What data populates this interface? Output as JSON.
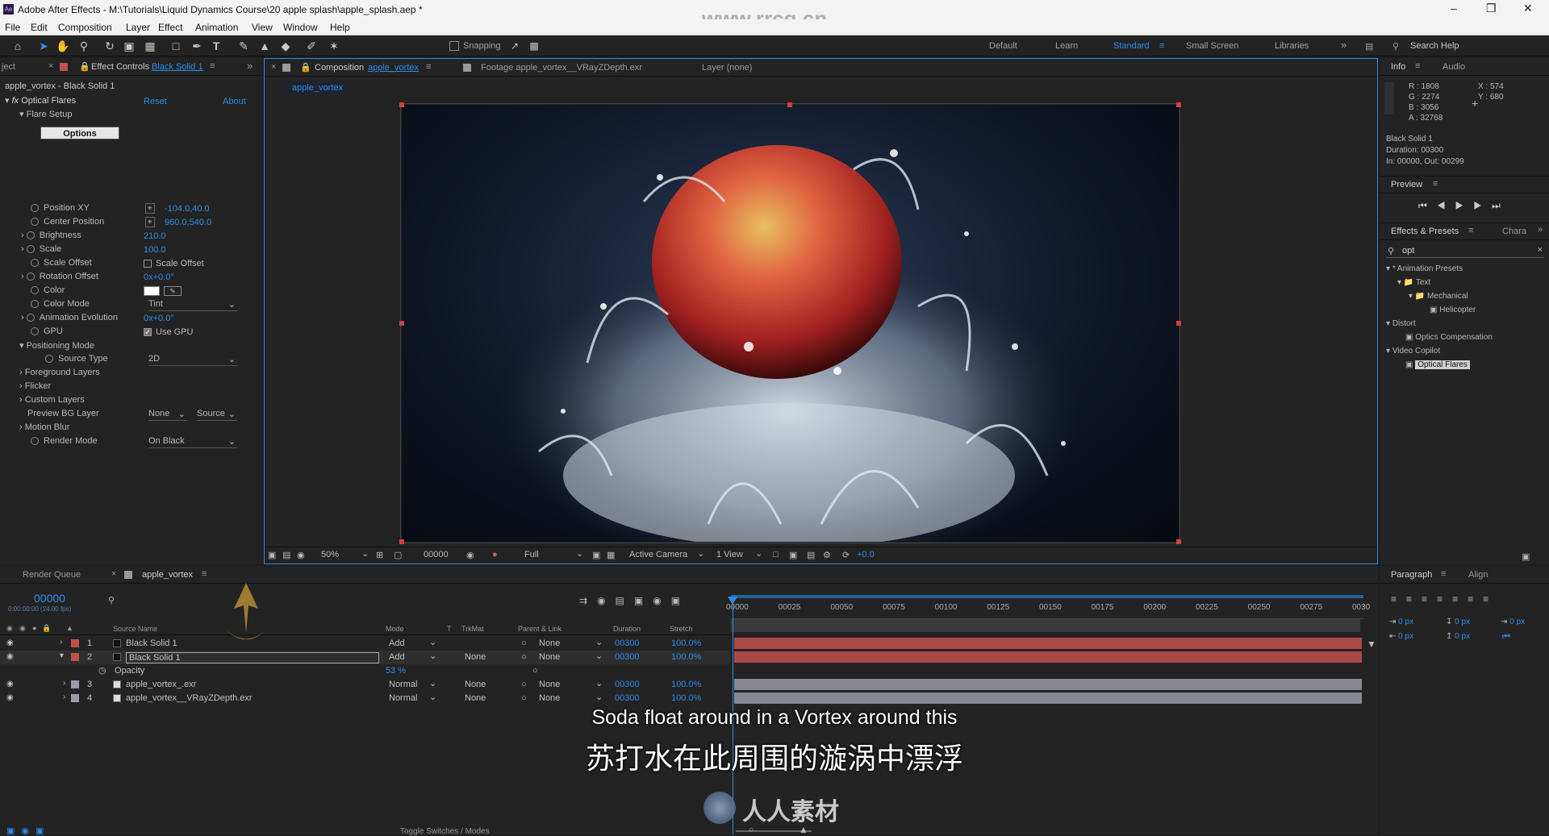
{
  "window": {
    "title": "Adobe After Effects - M:\\Tutorials\\Liquid Dynamics Course\\20 apple splash\\apple_splash.aep *",
    "watermark_url": "www.rrcg.cn"
  },
  "menu": [
    "File",
    "Edit",
    "Composition",
    "Layer",
    "Effect",
    "Animation",
    "View",
    "Window",
    "Help"
  ],
  "toolbar": {
    "snapping": "Snapping",
    "workspaces": [
      "Default",
      "Learn",
      "Standard",
      "Small Screen",
      "Libraries"
    ],
    "search": "Search Help"
  },
  "colors": {
    "accent": "#2d8ceb",
    "layer_red": "#c0504d",
    "layer_gray": "#9a9aa8",
    "bg": "#232323"
  },
  "effect_controls": {
    "tabs": [
      "ject",
      "Effect Controls",
      "Black Solid 1"
    ],
    "layer_path": "apple_vortex - Black Solid 1",
    "effect_name": "Optical Flares",
    "reset": "Reset",
    "about": "About",
    "flare_setup": "Flare Setup",
    "options_button": "Options",
    "props": [
      {
        "name": "Position XY",
        "value": "-104.0,40.0"
      },
      {
        "name": "Center Position",
        "value": "960.0,540.0"
      },
      {
        "name": "Brightness",
        "value": "210.0"
      },
      {
        "name": "Scale",
        "value": "100.0"
      },
      {
        "name": "Scale Offset",
        "value": "Scale Offset"
      },
      {
        "name": "Rotation Offset",
        "value": "0x+0.0°"
      },
      {
        "name": "Color",
        "value": ""
      },
      {
        "name": "Color Mode",
        "value": "Tint"
      },
      {
        "name": "Animation Evolution",
        "value": "0x+0.0°"
      },
      {
        "name": "GPU",
        "value": "Use GPU"
      }
    ],
    "positioning_mode": "Positioning Mode",
    "source_type_label": "Source Type",
    "source_type": "2D",
    "groups": [
      "Foreground Layers",
      "Flicker",
      "Custom Layers"
    ],
    "preview_bg_label": "Preview BG Layer",
    "preview_bg": "None",
    "preview_bg_source": "Source",
    "motion_blur": "Motion Blur",
    "render_mode_label": "Render Mode",
    "render_mode": "On Black"
  },
  "composition": {
    "tab_label": "Composition",
    "comp_name": "apple_vortex",
    "footage_tab": "Footage apple_vortex__VRayZDepth.exr",
    "layer_tab": "Layer (none)",
    "crumb": "apple_vortex",
    "viewer_bar": {
      "zoom": "50%",
      "timecode": "00000",
      "resolution": "Full",
      "camera": "Active Camera",
      "view": "1 View",
      "exposure": "+0.0"
    }
  },
  "info": {
    "tabs": [
      "Info",
      "Audio"
    ],
    "r": "R : 1808",
    "g": "G : 2274",
    "b": "B : 3056",
    "a": "A : 32768",
    "x": "X : 574",
    "y": "Y : 680",
    "layer": "Black Solid 1",
    "duration": "Duration: 00300",
    "inout": "In: 00000, Out: 00299"
  },
  "preview": {
    "title": "Preview"
  },
  "effects_presets": {
    "tabs": [
      "Effects & Presets",
      "Chara"
    ],
    "search": "opt",
    "tree": [
      {
        "label": "* Animation Presets",
        "level": 0
      },
      {
        "label": "Text",
        "level": 1
      },
      {
        "label": "Mechanical",
        "level": 2
      },
      {
        "label": "Helicopter",
        "level": 3
      },
      {
        "label": "Distort",
        "level": 0
      },
      {
        "label": "Optics Compensation",
        "level": 1
      },
      {
        "label": "Video Copilot",
        "level": 0
      },
      {
        "label": "Optical Flares",
        "level": 1
      }
    ]
  },
  "paragraph": {
    "tabs": [
      "Paragraph",
      "Align"
    ],
    "fields": [
      "0 px",
      "0 px",
      "0 px",
      "0 px",
      "0 px"
    ]
  },
  "timeline": {
    "tabs": [
      "Render Queue",
      "apple_vortex"
    ],
    "timecode": "00000",
    "sub_timecode": "0:00:00:00 (24.00 fps)",
    "columns": [
      "Source Name",
      "Mode",
      "T",
      "TrkMat",
      "Parent & Link",
      "Duration",
      "Stretch"
    ],
    "ruler": [
      "00000",
      "00025",
      "00050",
      "00075",
      "00100",
      "00125",
      "00150",
      "00175",
      "00200",
      "00225",
      "00250",
      "00275",
      "0030"
    ],
    "layers": [
      {
        "num": "1",
        "name": "Black Solid 1",
        "mode": "Add",
        "trkmat": "",
        "parent": "None",
        "duration": "00300",
        "stretch": "100.0%",
        "color": "#c0504d"
      },
      {
        "num": "2",
        "name": "Black Solid 1",
        "mode": "Add",
        "trkmat": "None",
        "parent": "None",
        "duration": "00300",
        "stretch": "100.0%",
        "color": "#c0504d"
      },
      {
        "num": "3",
        "name": "apple_vortex_.exr",
        "mode": "Normal",
        "trkmat": "None",
        "parent": "None",
        "duration": "00300",
        "stretch": "100.0%",
        "color": "#9a9aa8"
      },
      {
        "num": "4",
        "name": "apple_vortex__VRayZDepth.exr",
        "mode": "Normal",
        "trkmat": "None",
        "parent": "None",
        "duration": "00300",
        "stretch": "100.0%",
        "color": "#9a9aa8"
      }
    ],
    "opacity_label": "Opacity",
    "opacity_value": "53 %",
    "toggle": "Toggle Switches / Modes"
  },
  "subtitles": {
    "en": "Soda float around in a Vortex around this",
    "zh": "苏打水在此周围的漩涡中漂浮"
  },
  "logo_text": "人人素材"
}
